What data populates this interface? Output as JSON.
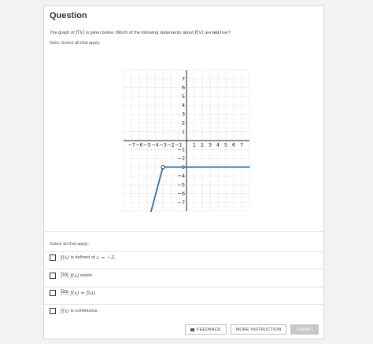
{
  "question": {
    "title": "Question",
    "prompt_pre": "The graph of",
    "prompt_fx": "f(x)",
    "prompt_mid": "is given below. Which of the following statements about",
    "prompt_fx2": "f(x)",
    "prompt_post1": "are",
    "prompt_not": "not",
    "prompt_post2": "true?",
    "note": "Note: Select all that apply."
  },
  "graph": {
    "x_ticks": [
      "−7",
      "−6",
      "−5",
      "−4",
      "−3",
      "−2",
      "−1",
      "1",
      "2",
      "3",
      "4",
      "5",
      "6",
      "7"
    ],
    "y_ticks": [
      "7",
      "6",
      "5",
      "4",
      "3",
      "2",
      "1",
      "−1",
      "−2",
      "−3",
      "−4",
      "−5",
      "−6",
      "−7"
    ],
    "x_range": [
      -8,
      8
    ],
    "y_range": [
      -8,
      8
    ],
    "line_color": "#2a6fb0",
    "segments": [
      {
        "kind": "line",
        "from": [
          -4.5,
          -8
        ],
        "to": [
          -3,
          -3
        ]
      },
      {
        "kind": "line",
        "from": [
          -3,
          -3
        ],
        "to": [
          8,
          -3
        ]
      }
    ],
    "open_point": [
      -3,
      -3
    ]
  },
  "answers": {
    "instruction": "Select all that apply:",
    "options": [
      {
        "math": "f(x)",
        "text": "is defined at",
        "math2": "x = −3."
      },
      {
        "lim": "lim",
        "sub": "x→−3",
        "math": "f(x)",
        "text": "exists."
      },
      {
        "lim": "lim",
        "sub": "x→−3",
        "math": "f(x) = f(a)."
      },
      {
        "math": "f(x)",
        "text": "is continuous."
      }
    ]
  },
  "buttons": {
    "feedback": "FEEDBACK",
    "more": "MORE INSTRUCTION",
    "submit": "SUBMIT"
  }
}
